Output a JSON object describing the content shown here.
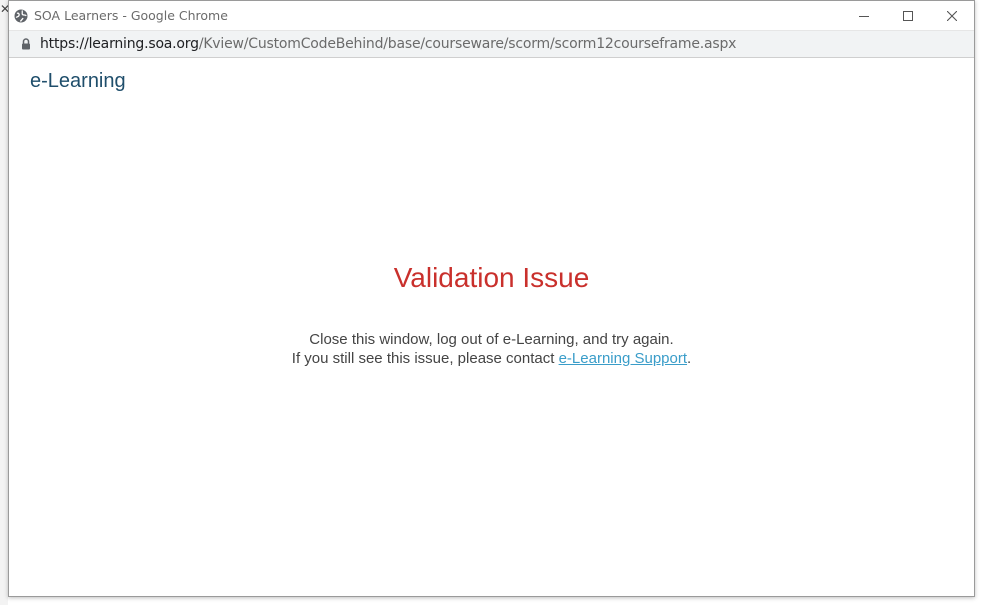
{
  "background": {
    "close_glyph": "✕"
  },
  "window": {
    "title": "SOA Learners - Google Chrome",
    "icon": "globe-icon",
    "controls": [
      "minimize-icon",
      "maximize-icon",
      "close-icon"
    ]
  },
  "address": {
    "icon": "lock-icon",
    "host": "https://learning.soa.org",
    "path": "/Kview/CustomCodeBehind/base/courseware/scorm/scorm12courseframe.aspx"
  },
  "page": {
    "brand": "e-Learning",
    "issue_title": "Validation Issue",
    "line1": "Close this window, log out of e-Learning, and try again.",
    "line2_prefix": "If you still see this issue, please contact ",
    "support_link": "e-Learning Support",
    "line2_suffix": "."
  },
  "colors": {
    "brand": "#1f4e6b",
    "error": "#c9302c",
    "link": "#3a9dc9"
  }
}
